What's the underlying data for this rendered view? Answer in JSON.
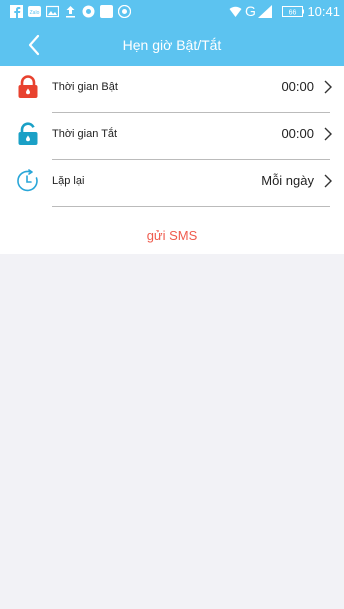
{
  "status_bar": {
    "time": "10:41",
    "network": "G",
    "battery": "66"
  },
  "app_bar": {
    "title": "Hẹn giờ Bật/Tắt"
  },
  "rows": [
    {
      "label": "Thời gian Bật",
      "value": "00:00",
      "icon": "lock-closed-icon",
      "icon_color": "#e8422f"
    },
    {
      "label": "Thời gian Tắt",
      "value": "00:00",
      "icon": "lock-open-icon",
      "icon_color": "#1aa0c6"
    },
    {
      "label": "Lặp lại",
      "value": "Mỗi ngày",
      "icon": "clock-repeat-icon",
      "icon_color": "#29a6d8"
    }
  ],
  "send_sms_label": "gửi SMS",
  "colors": {
    "accent": "#5cc3f0",
    "sms": "#ef5b4d",
    "background": "#f2f2f6"
  }
}
